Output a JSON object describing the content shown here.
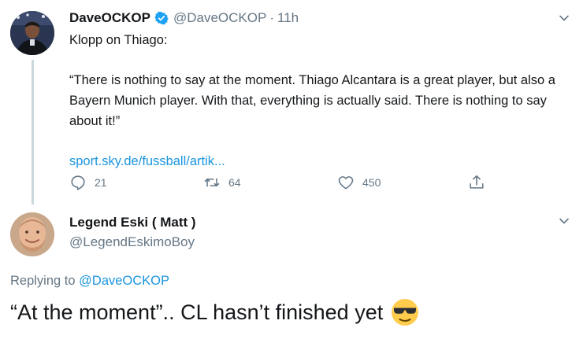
{
  "original_tweet": {
    "display_name": "DaveOCKOP",
    "handle": "@DaveOCKOP",
    "separator": "·",
    "time": "11h",
    "text_line1": "Klopp on Thiago:",
    "text_quote": "“There is nothing to say at the moment. Thiago Alcantara is a great player, but also a Bayern Munich player. With that, everything is actually said. There is nothing to say about it!”",
    "link": "sport.sky.de/fussball/artik...",
    "actions": {
      "reply_count": "21",
      "retweet_count": "64",
      "like_count": "450"
    },
    "icons": [
      "verified-icon",
      "chevron-down-icon",
      "reply-icon",
      "retweet-icon",
      "like-icon",
      "share-icon"
    ],
    "colors": {
      "link": "#1b95e0",
      "verified": "#1da1f2",
      "muted": "#657786"
    }
  },
  "reply_tweet": {
    "display_name": "Legend Eski ( Matt )",
    "handle": "@LegendEskimoBoy",
    "replying_prefix": "Replying to",
    "replying_handle": "@DaveOCKOP",
    "text": "“At the moment”.. CL hasn’t finished yet",
    "emoji": "sunglasses-emoji"
  }
}
